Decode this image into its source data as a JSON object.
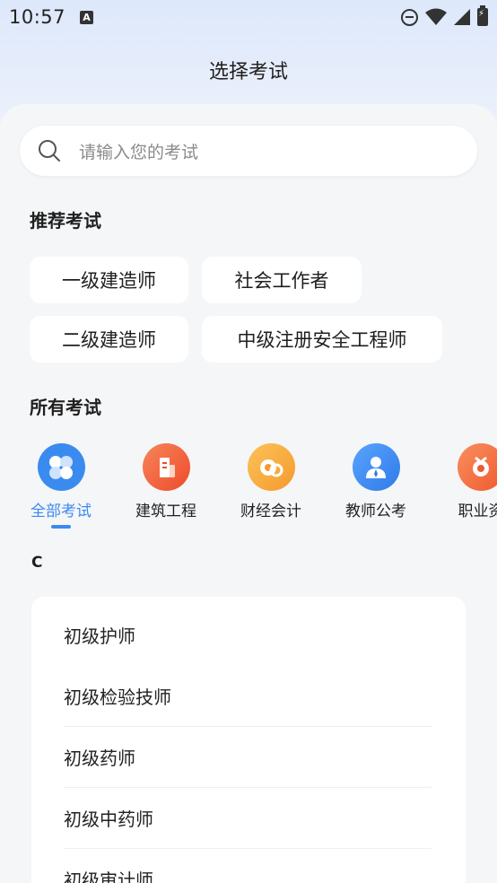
{
  "status_bar": {
    "time": "10:57",
    "a_badge": "A"
  },
  "header": {
    "title": "选择考试"
  },
  "search": {
    "placeholder": "请输入您的考试"
  },
  "recommended": {
    "title": "推荐考试",
    "chips": [
      "一级建造师",
      "社会工作者",
      "二级建造师",
      "中级注册安全工程师"
    ]
  },
  "all_exams": {
    "title": "所有考试",
    "categories": [
      {
        "label": "全部考试",
        "icon": "four-petal-icon",
        "color": "#3a8bf0",
        "active": true
      },
      {
        "label": "建筑工程",
        "icon": "building-icon",
        "color": "#f2643c",
        "active": false
      },
      {
        "label": "财经会计",
        "icon": "coin-icon",
        "color": "#f7a43a",
        "active": false
      },
      {
        "label": "教师公考",
        "icon": "teacher-icon",
        "color": "#3a8bf0",
        "active": false
      },
      {
        "label": "职业资",
        "icon": "certificate-icon",
        "color": "#f4733c",
        "active": false
      }
    ]
  },
  "index_letter": "C",
  "exam_list": [
    "初级护师",
    "初级检验技师",
    "初级药师",
    "初级中药师",
    "初级审计师"
  ]
}
